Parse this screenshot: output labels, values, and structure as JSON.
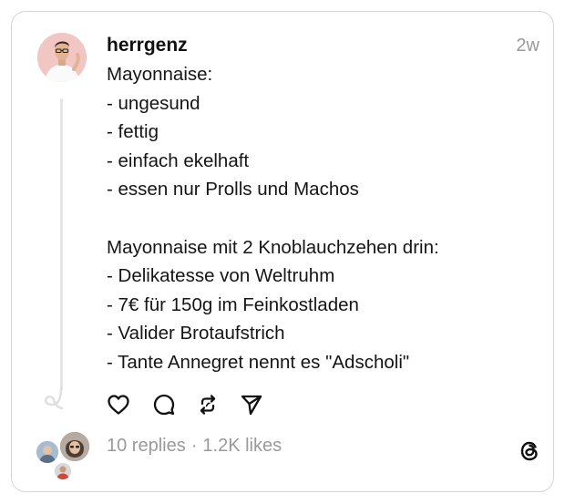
{
  "post": {
    "username": "herrgenz",
    "time": "2w",
    "lines": [
      "Mayonnaise:",
      "- ungesund",
      "- fettig",
      "- einfach ekelhaft",
      "- essen nur Prolls und Machos",
      "",
      "Mayonnaise mit 2 Knoblauchzehen drin:",
      "- Delikatesse von Weltruhm",
      "- 7€ für 150g im Feinkostladen",
      "- Valider Brotaufstrich",
      "- Tante Annegret nennt es \"Adscholi\""
    ]
  },
  "actions": {
    "like_icon": "heart-icon",
    "reply_icon": "comment-icon",
    "repost_icon": "repost-icon",
    "share_icon": "send-icon"
  },
  "stats": {
    "replies": "10 replies",
    "separator": "·",
    "likes": "1.2K likes"
  },
  "colors": {
    "border": "#d6d6d6",
    "muted_text": "#9a9a9a",
    "text": "#111111",
    "thread_line": "#e5e5e5"
  }
}
